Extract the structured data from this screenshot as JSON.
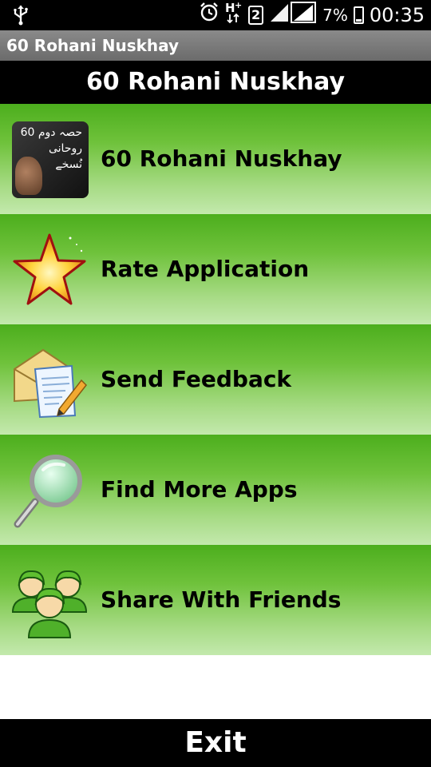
{
  "status_bar": {
    "network_badge": "2",
    "battery_percent": "7%",
    "time": "00:35",
    "icons": [
      "usb-icon",
      "alarm-icon",
      "hspa-plus-icon",
      "signal-icon",
      "battery-charging-icon"
    ]
  },
  "app_title": "60 Rohani Nuskhay",
  "header_title": "60 Rohani Nuskhay",
  "book_cover": {
    "line1": "60 حصہ دوم",
    "line2": "روحانی",
    "line3": "نُسخے"
  },
  "menu": {
    "items": [
      {
        "label": "60 Rohani Nuskhay",
        "icon": "book-cover-icon"
      },
      {
        "label": "Rate Application",
        "icon": "star-icon"
      },
      {
        "label": "Send Feedback",
        "icon": "envelope-document-icon"
      },
      {
        "label": "Find More Apps",
        "icon": "magnifier-icon"
      },
      {
        "label": "Share With Friends",
        "icon": "people-group-icon"
      }
    ]
  },
  "exit_label": "Exit",
  "colors": {
    "item_top": "#4cae1d",
    "item_bottom": "#c3e9ad",
    "bars": "#000000"
  }
}
